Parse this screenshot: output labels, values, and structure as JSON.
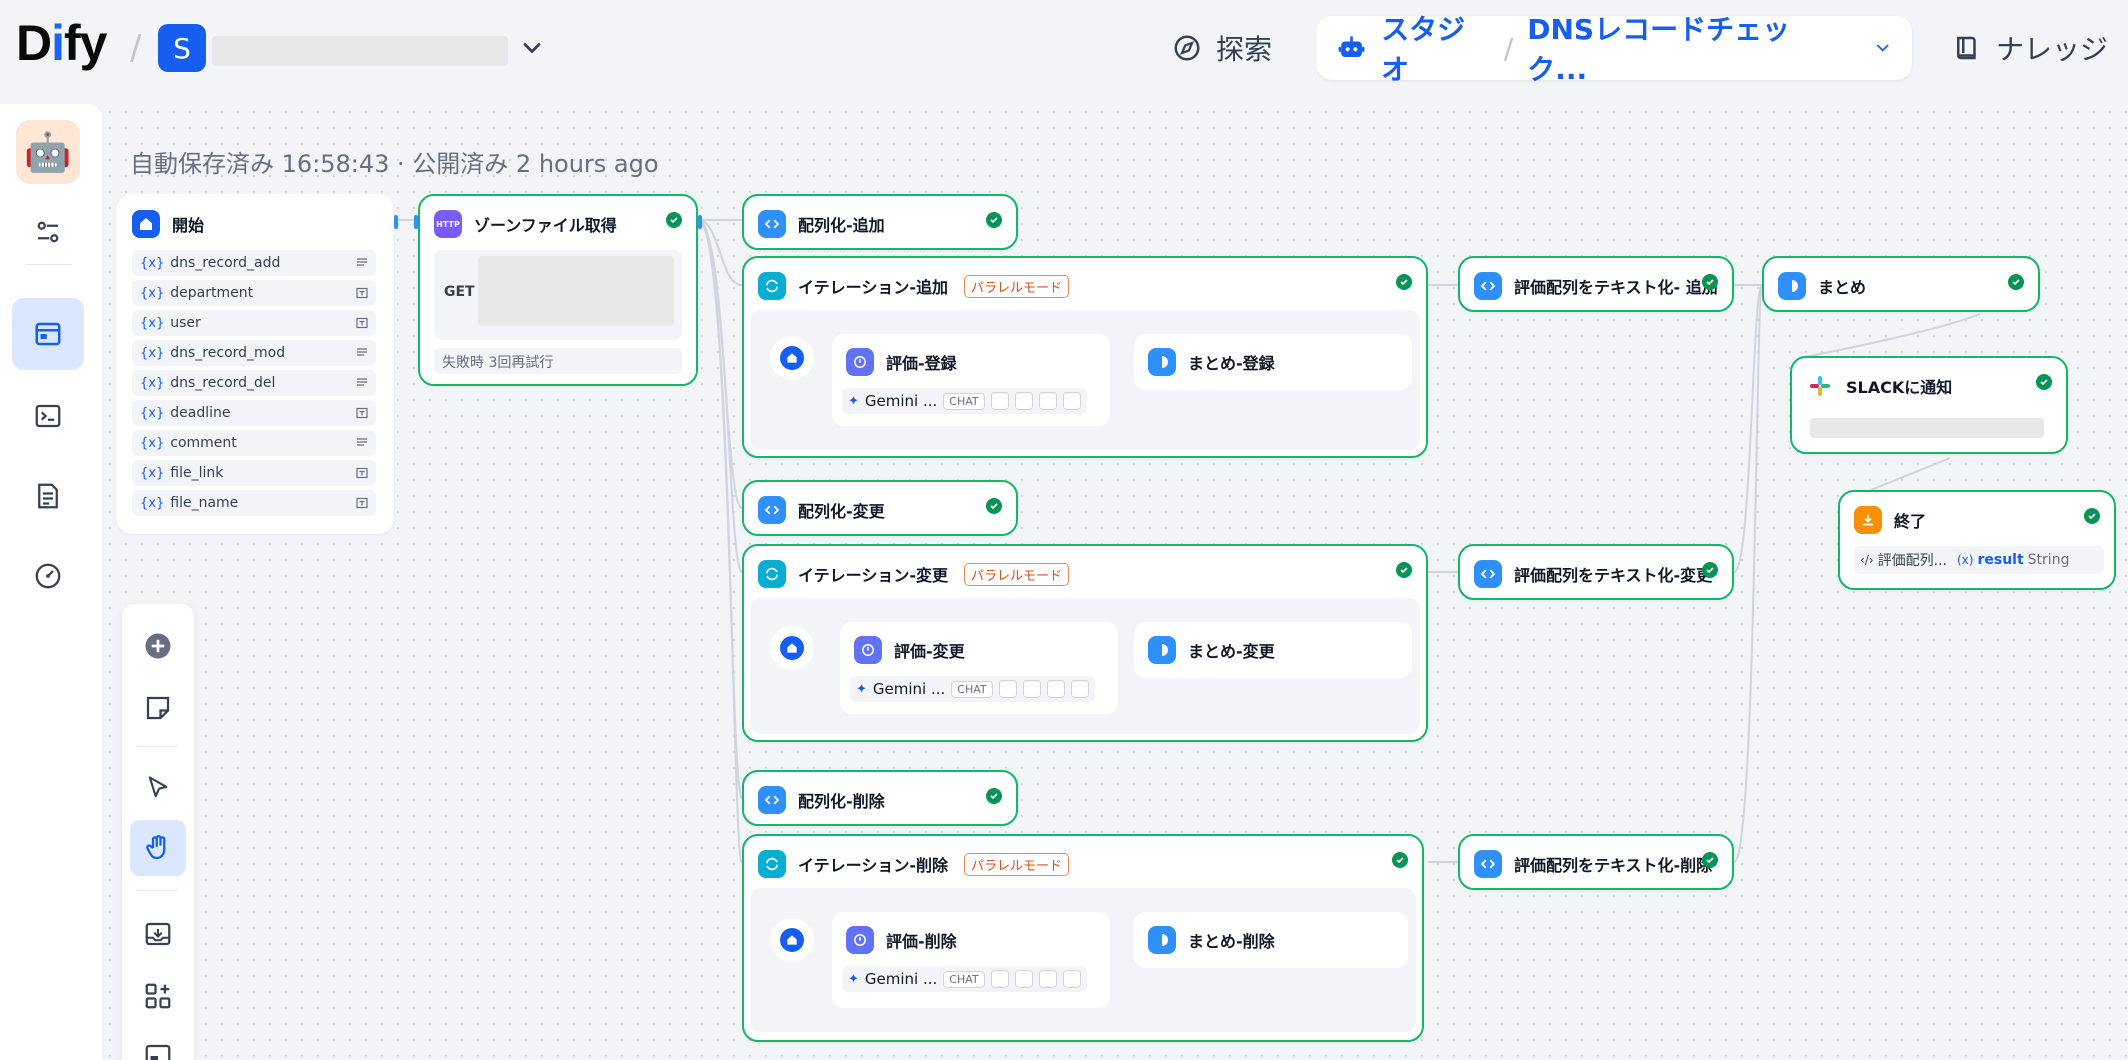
{
  "header": {
    "logo_pre": "D",
    "logo_i": "i",
    "logo_post": "fy",
    "workspace_initial": "S",
    "explore": "探索",
    "studio": "スタジオ",
    "app_name": "DNSレコードチェック...",
    "knowledge": "ナレッジ"
  },
  "status": {
    "saved": "自動保存済み 16:58:43 · 公開済み 2 hours ago"
  },
  "start_node": {
    "title": "開始",
    "vars": [
      "dns_record_add",
      "department",
      "user",
      "dns_record_mod",
      "dns_record_del",
      "deadline",
      "comment",
      "file_link",
      "file_name"
    ]
  },
  "http_node": {
    "title": "ゾーンファイル取得",
    "method": "GET",
    "retry": "失敗時 3回再試行"
  },
  "nodes": {
    "arr_add": "配列化-追加",
    "iter_add": "イテレーション-追加",
    "parallel_mode": "パラレルモード",
    "eval_add": "評価-登録",
    "sum_add": "まとめ-登録",
    "arr_mod": "配列化-変更",
    "iter_mod": "イテレーション-変更",
    "eval_mod": "評価-変更",
    "sum_mod": "まとめ-変更",
    "arr_del": "配列化-削除",
    "iter_del": "イテレーション-削除",
    "eval_del": "評価-削除",
    "sum_del": "まとめ-削除",
    "text_add": "評価配列をテキスト化- 追加",
    "text_mod": "評価配列をテキスト化-変更",
    "text_del": "評価配列をテキスト化-削除",
    "summary": "まとめ",
    "slack": "SLACKに通知",
    "end": "終了"
  },
  "model": {
    "name": "Gemini ...",
    "mode": "CHAT"
  },
  "end_output": {
    "source": "評価配列...",
    "var_prefix": "(x)",
    "var": "result",
    "type": "String"
  }
}
